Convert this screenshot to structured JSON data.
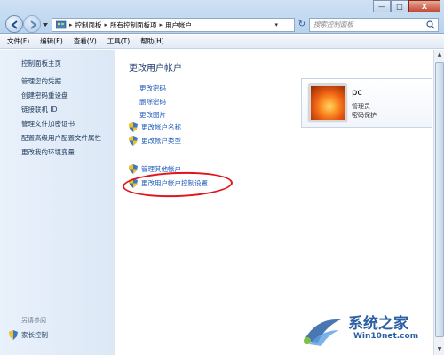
{
  "window": {
    "breadcrumb": [
      "控制面板",
      "所有控制面板项",
      "用户帐户"
    ],
    "search_placeholder": "搜索控制面板",
    "controls": {
      "minimize": "—",
      "maximize": "□",
      "close": "X"
    }
  },
  "menubar": [
    "文件(F)",
    "编辑(E)",
    "查看(V)",
    "工具(T)",
    "帮助(H)"
  ],
  "sidebar": {
    "home": "控制面板主页",
    "links": [
      "管理您的凭据",
      "创建密码重设盘",
      "链接联机 ID",
      "管理文件加密证书",
      "配置高级用户配置文件属性",
      "更改我的环境变量"
    ],
    "see_also_label": "另请参阅",
    "family_safety": "家长控制"
  },
  "main": {
    "title": "更改用户帐户",
    "tasks": [
      "更改密码",
      "删除密码",
      "更改图片"
    ],
    "shield_tasks": [
      "更改帐户名称",
      "更改帐户类型"
    ],
    "other_tasks": [
      "管理其他帐户",
      "更改用户帐户控制设置"
    ]
  },
  "account": {
    "name": "pc",
    "role": "管理员",
    "status": "密码保护"
  },
  "watermark": {
    "title": "系统之家",
    "site": "Win10net.com"
  },
  "colors": {
    "link": "#1e5bb8",
    "highlight": "#e2141b",
    "watermark": "#2a5fa3"
  }
}
